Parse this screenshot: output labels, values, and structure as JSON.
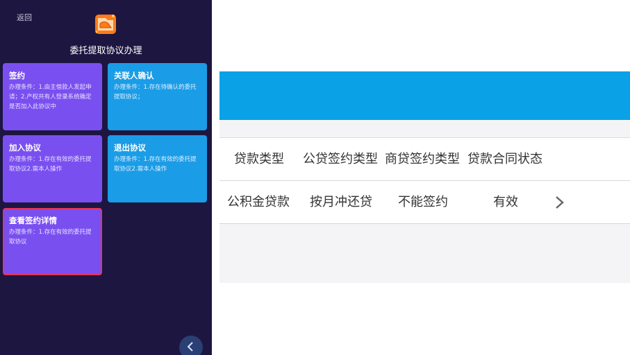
{
  "phone": {
    "back_label": "返回",
    "title": "委托提取协议办理",
    "cards": [
      {
        "title": "签约",
        "lines": [
          "办理条件：1.由主借款人发起申",
          "请；2.产权共有人登录系统确定",
          "是否加入此协议中"
        ],
        "color": "#7a4ff0"
      },
      {
        "title": "关联人确认",
        "lines": [
          "办理条件：1.存在待确认的委托",
          "提取协议；"
        ],
        "color": "#1b9ce6"
      },
      {
        "title": "加入协议",
        "lines": [
          "办理条件：1.存在有效的委托提",
          "取协议2.需本人操作"
        ],
        "color": "#7a4ff0"
      },
      {
        "title": "退出协议",
        "lines": [
          "办理条件：1.存在有效的委托提",
          "取协议2.需本人操作"
        ],
        "color": "#1b9ce6"
      },
      {
        "title": "查看签约详情",
        "lines": [
          "办理条件：1.存在有效的委托提",
          "取协议"
        ],
        "color": "#7a4ff0"
      }
    ]
  },
  "table": {
    "headers": [
      "贷款类型",
      "公贷签约类型",
      "商贷签约类型",
      "贷款合同状态"
    ],
    "row": [
      "公积金贷款",
      "按月冲还贷",
      "不能签约",
      "有效"
    ]
  },
  "colors": {
    "phone_bg": "#1d1640",
    "purple_card": "#7a4ff0",
    "blue_card": "#1b9ce6",
    "selected_border": "#e4355c",
    "header_blue": "#0aa1e6"
  },
  "icons": {
    "logo": "folder-hand-icon",
    "fab": "chevron-left-icon",
    "row_arrow": "chevron-right-icon"
  }
}
